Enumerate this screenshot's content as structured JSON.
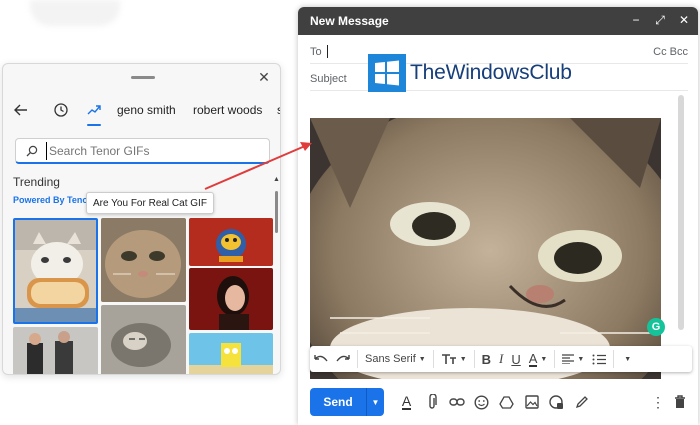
{
  "emoji_panel": {
    "tabs": [
      "geno smith",
      "robert woods",
      "s"
    ],
    "search_placeholder": "Search Tenor GIFs",
    "section_title": "Trending",
    "powered_by": "Powered By Tenor",
    "tooltip": "Are You For Real Cat GIF"
  },
  "compose": {
    "title": "New Message",
    "to_label": "To",
    "cc_bcc": "Cc Bcc",
    "subject_label": "Subject",
    "watermark": "TheWindowsClub",
    "grammarly": "G",
    "format_bar": {
      "font": "Sans Serif"
    },
    "send_label": "Send"
  },
  "colors": {
    "accent": "#1a73e8",
    "header": "#404040",
    "arrow": "#e03c3c"
  }
}
